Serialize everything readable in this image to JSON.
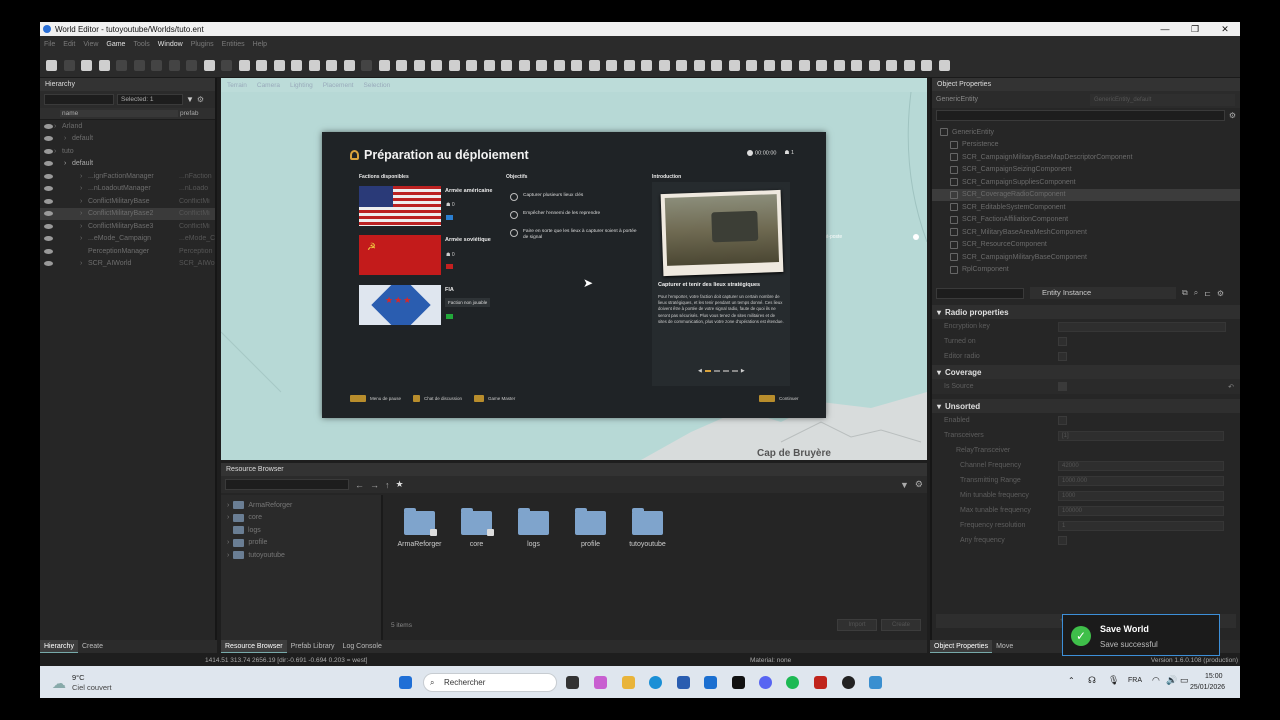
{
  "window": {
    "title": "World Editor - tutoyoutube/Worlds/tuto.ent",
    "min": "—",
    "max": "❐",
    "close": "✕"
  },
  "menu": [
    "File",
    "Edit",
    "View",
    "Game",
    "Tools",
    "Window",
    "Plugins",
    "Entities",
    "Help"
  ],
  "hierarchy": {
    "title": "Hierarchy",
    "selected": "Selected: 1",
    "col_name": "name",
    "col_prefab": "prefab",
    "rows": [
      {
        "name": "Arland",
        "prefab": ""
      },
      {
        "name": "default",
        "prefab": ""
      },
      {
        "name": "tuto",
        "prefab": ""
      },
      {
        "name": "default",
        "prefab": ""
      },
      {
        "name": "...ignFactionManager",
        "prefab": "...nFaction"
      },
      {
        "name": "...nLoadoutManager",
        "prefab": "...nLoado"
      },
      {
        "name": "ConflictMilitaryBase",
        "prefab": "ConflictMi"
      },
      {
        "name": "ConflictMilitaryBase2",
        "prefab": "ConflictMi"
      },
      {
        "name": "ConflictMilitaryBase3",
        "prefab": "ConflictMi"
      },
      {
        "name": "...eMode_Campaign",
        "prefab": "...eMode_C"
      },
      {
        "name": "PerceptionManager",
        "prefab": "Perception"
      },
      {
        "name": "SCR_AIWorld",
        "prefab": "SCR_AIWo"
      }
    ]
  },
  "left_tabs": [
    "Hierarchy",
    "Create"
  ],
  "viewport": {
    "header": [
      "Terrain",
      "Camera",
      "Lighting",
      "Placement",
      "Selection"
    ],
    "map_label": "Cap de Bruyère",
    "marker_label": "(Vaisa) Avant-poste"
  },
  "dialog": {
    "title": "Préparation au déploiement",
    "timer": "00:00:00",
    "players": "1",
    "col_factions": "Factions disponibles",
    "col_objectives": "Objectifs",
    "col_intro": "Introduction",
    "factions": [
      {
        "name": "Armée américaine",
        "count": "0",
        "color": "#2b7fd1"
      },
      {
        "name": "Armée soviétique",
        "count": "0",
        "color": "#c42020"
      },
      {
        "name": "FIA",
        "note": "Faction non jouable",
        "color": "#22a83a"
      }
    ],
    "objectives": [
      "Capturer plusieurs lieux clés",
      "Empêcher l'ennemi de les reprendre",
      "Faire en sorte que les lieux à capturer soient à portée de signal"
    ],
    "intro_title": "Capturer et tenir des lieux stratégiques",
    "intro_text": "Pour l'emporter, votre faction doit capturer un certain nombre de lieux stratégiques, et les tenir pendant un temps donné. Ces lieux doivent être à portée de votre signal radio, faute de quoi ils ne seront pas sécurisés. Plus vous tenez de sites militaires et de sites de communication, plus votre zone d'opérations est étendue.",
    "footer": [
      "Menu de pause",
      "Chat de discussion",
      "Game Master"
    ],
    "continue": "Continuer"
  },
  "resource_browser": {
    "title": "Resource Browser",
    "tree": [
      "ArmaReforger",
      "core",
      "logs",
      "profile",
      "tutoyoutube"
    ],
    "items": [
      "ArmaReforger",
      "core",
      "logs",
      "profile",
      "tutoyoutube"
    ],
    "count": "5 items",
    "btn1": "Import",
    "btn2": "Create"
  },
  "bottom_tabs": [
    "Resource Browser",
    "Prefab Library",
    "Log Console"
  ],
  "props": {
    "title": "Object Properties",
    "entity": "GenericEntity",
    "entity_right": "GenericEntity_default",
    "components": [
      "GenericEntity",
      "Persistence",
      "SCR_CampaignMilitaryBaseMapDescriptorComponent",
      "SCR_CampaignSeizingComponent",
      "SCR_CampaignSuppliesComponent",
      "SCR_CoverageRadioComponent",
      "SCR_EditableSystemComponent",
      "SCR_FactionAffiliationComponent",
      "SCR_MilitaryBaseAreaMeshComponent",
      "SCR_ResourceComponent",
      "SCR_CampaignMilitaryBaseComponent",
      "RplComponent"
    ],
    "filter": "Entity Instance",
    "sections": [
      {
        "title": "Radio properties",
        "fields": [
          "Encryption key",
          "Turned on",
          "Editor radio"
        ]
      },
      {
        "title": "Coverage",
        "fields": [
          "Is Source"
        ]
      },
      {
        "title": "Unsorted",
        "fields": [
          "Enabled",
          "Transceivers",
          "RelayTransceiver",
          "Channel Frequency",
          "Transmitting Range",
          "Min tunable frequency",
          "Max tunable frequency",
          "Frequency resolution",
          "Any frequency"
        ]
      }
    ],
    "transceivers_value": "[1]",
    "values": [
      "42000",
      "1000.000",
      "1000",
      "100000",
      "1"
    ],
    "add_component": "+ Add Component"
  },
  "right_tabs": [
    "Object Properties",
    "Move"
  ],
  "toast": {
    "title": "Save World",
    "message": "Save successful"
  },
  "status": {
    "coords": "1414.51     313.74     2656.19 [dir:-0.691 -0.694  0.203 = west]",
    "material": "Material: none",
    "version": "Version 1.6.0.108 (production)"
  },
  "taskbar": {
    "weather_temp": "9°C",
    "weather_desc": "Ciel couvert",
    "search": "Rechercher",
    "lang": "FRA",
    "time": "15:00",
    "date": "25/01/2026"
  }
}
